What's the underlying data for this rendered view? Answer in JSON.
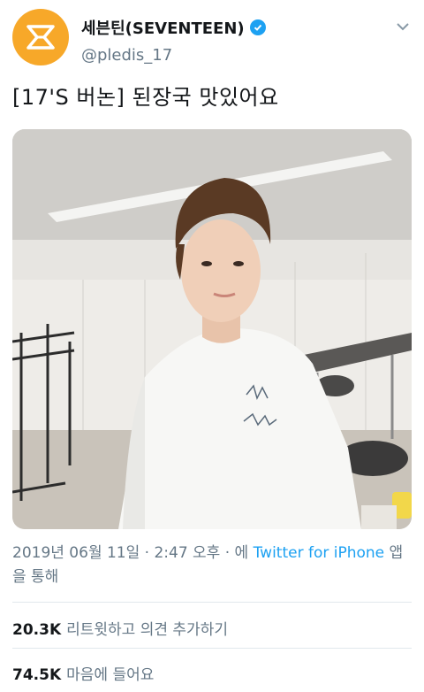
{
  "account": {
    "display_name": "세븐틴(SEVENTEEN)",
    "handle": "@pledis_17",
    "brand_color": "#f7a829",
    "verified_color": "#1da1f2"
  },
  "tweet": {
    "text": "[17'S 버논] 된장국 맛있어요",
    "photo_icon": "photo-person-in-white-tshirt"
  },
  "meta": {
    "date_time": "2019년 06월 11일 · 2:47 오후 · 에 ",
    "source_link": "Twitter for iPhone",
    "suffix": " 앱을 통해"
  },
  "stats": {
    "retweets_count": "20.3K",
    "retweets_label": "리트윗하고 의견 추가하기",
    "likes_count": "74.5K",
    "likes_label": "마음에 들어요"
  }
}
